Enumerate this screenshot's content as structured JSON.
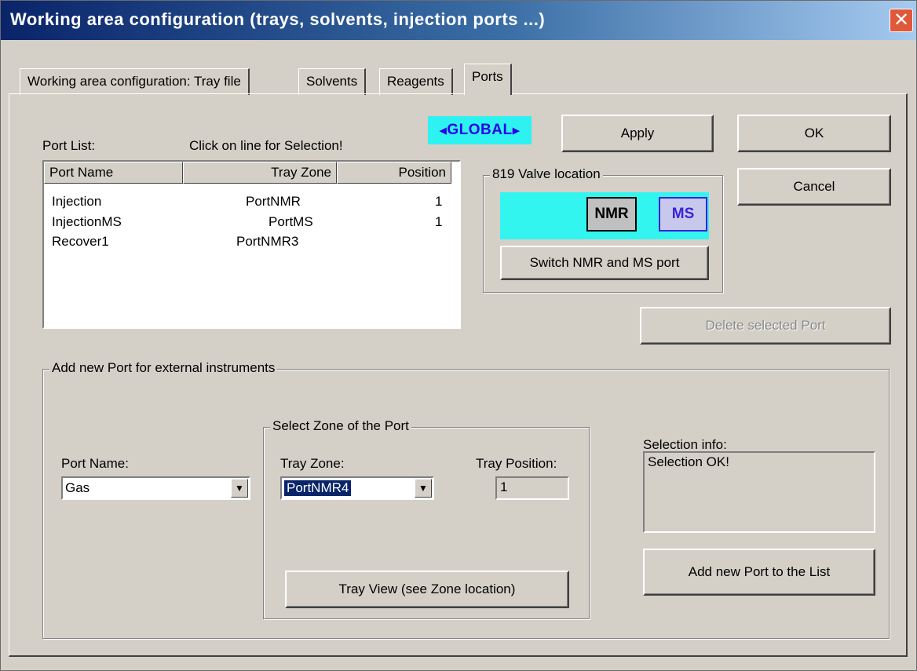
{
  "window": {
    "title": "Working area configuration (trays, solvents, injection ports ...)",
    "close_glyph": "✕"
  },
  "tabs": [
    {
      "label": "Working area configuration: Tray file",
      "active": false
    },
    {
      "label": "Solvents",
      "active": false
    },
    {
      "label": "Reagents",
      "active": false
    },
    {
      "label": "Ports",
      "active": true
    }
  ],
  "port_list": {
    "label": "Port List:",
    "hint": "Click on line for Selection!",
    "columns": [
      "Port Name",
      "Tray Zone",
      "Position"
    ],
    "rows": [
      {
        "name": "Injection",
        "zone": "PortNMR",
        "position": "1"
      },
      {
        "name": "InjectionMS",
        "zone": "PortMS",
        "position": "1"
      },
      {
        "name": "Recover1",
        "zone": "PortNMR3",
        "position": ""
      }
    ]
  },
  "global_badge": {
    "text": "GLOBAL",
    "color": "#2a00e8",
    "background": "#2ef2f2"
  },
  "buttons": {
    "apply": "Apply",
    "ok": "OK",
    "cancel": "Cancel",
    "delete_port": "Delete selected Port",
    "switch_ports": "Switch NMR and MS port",
    "tray_view": "Tray View (see Zone location)",
    "add_port": "Add new Port to the List"
  },
  "valve": {
    "group_title": "819 Valve location",
    "nmr_label": "NMR",
    "ms_label": "MS"
  },
  "add_port": {
    "group_title": "Add new Port for external instruments",
    "port_name_label": "Port Name:",
    "port_name_value": "Gas",
    "zone_group_title": "Select Zone of the Port",
    "tray_zone_label": "Tray Zone:",
    "tray_zone_value": "PortNMR4",
    "tray_position_label": "Tray Position:",
    "tray_position_value": "1",
    "selection_info_label": "Selection info:",
    "selection_info_value": "Selection OK!"
  }
}
